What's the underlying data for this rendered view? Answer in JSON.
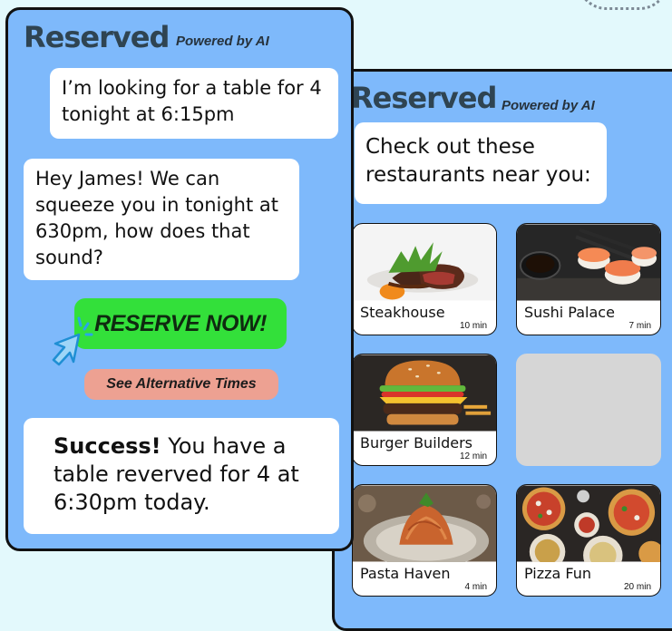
{
  "left_panel": {
    "brand": "Reserved",
    "powered_by": "Powered by AI",
    "user_message": "I’m looking for a table for 4 tonight at 6:15pm",
    "assistant_message": "Hey James! We can squeeze you in tonight at 630pm, how does that sound?",
    "reserve_button": "RESERVE NOW!",
    "alternative_button": "See Alternative Times",
    "success_bold": "Success!",
    "success_text": " You have a table reverved for 4 at 6:30pm today."
  },
  "right_panel": {
    "brand": "Reserved",
    "powered_by": "Powered by AI",
    "message": "Check out these restaurants near you:",
    "restaurants": [
      {
        "name": "Steakhouse",
        "time": "10 min"
      },
      {
        "name": "Sushi Palace",
        "time": "7 min"
      },
      {
        "name": "Burger Builders",
        "time": "12 min"
      },
      {
        "name": "Pasta Haven",
        "time": "4 min"
      },
      {
        "name": "Pizza Fun",
        "time": "20 min"
      }
    ]
  },
  "colors": {
    "background": "#e3f9fc",
    "panel": "#7eb9fb",
    "brand_text": "#2f4452",
    "reserve_button": "#33e03a",
    "alternative_button": "#eda192",
    "cursor": "#2aa6e8"
  },
  "icons": [
    "cursor-click-icon"
  ]
}
